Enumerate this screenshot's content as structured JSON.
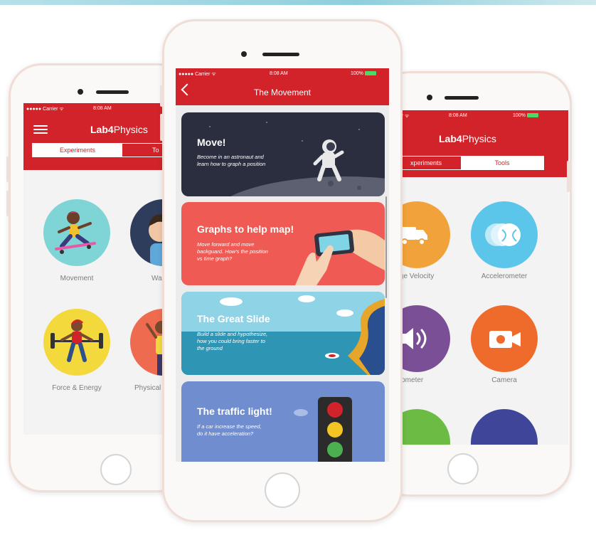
{
  "left_phone": {
    "status": {
      "carrier": "●●●●● Carrier ᯤ",
      "time": "8:08 AM"
    },
    "app_title_bold": "Lab4",
    "app_title_light": "Physics",
    "tab_experiments": "Experiments",
    "tab_tools": "To",
    "items": [
      {
        "label": "Movement",
        "color": "#7fd5d5"
      },
      {
        "label": "Wa",
        "color": "#2e3d5c"
      },
      {
        "label": "Force & Energy",
        "color": "#f3d93c"
      },
      {
        "label": "Physical M",
        "color": "#ef6b4f"
      }
    ]
  },
  "center_phone": {
    "status": {
      "carrier": "●●●●● Carrier ᯤ",
      "time": "8:08 AM",
      "battery": "100%"
    },
    "screen_title": "The Movement",
    "cards": [
      {
        "title": "Move!",
        "desc_1": "Become in an astronaut and",
        "desc_2": "learn how to graph a position",
        "color": "#2b2e3f"
      },
      {
        "title": "Graphs to help map!",
        "desc_1": "Move forward and move",
        "desc_2": "backguard. How's the position",
        "desc_3": "vs time graph?",
        "color": "#ef5a55"
      },
      {
        "title": "The Great Slide",
        "desc_1": "Build a slide and hypothesize,",
        "desc_2": "how you could bring faster to",
        "desc_3": "the ground",
        "color": "#3aa5c2"
      },
      {
        "title": "The traffic light!",
        "desc_1": "If a car increase the speed,",
        "desc_2": "do it have acceleration?",
        "color": "#6f8dcf"
      }
    ]
  },
  "right_phone": {
    "status": {
      "carrier": "rier ᯤ",
      "time": "8:08 AM",
      "battery": "100%"
    },
    "app_title_bold": "Lab4",
    "app_title_light": "Physics",
    "tab_experiments": "xperiments",
    "tab_tools": "Tools",
    "items": [
      {
        "label": "rage Velocity",
        "color": "#f2a23a"
      },
      {
        "label": "Accelerometer",
        "color": "#5cc6ea"
      },
      {
        "label": "onometer",
        "color": "#7b4f95"
      },
      {
        "label": "Camera",
        "color": "#ef6b2c"
      },
      {
        "label": "",
        "color": "#6cbb45"
      },
      {
        "label": "",
        "color": "#3f469a"
      }
    ]
  }
}
